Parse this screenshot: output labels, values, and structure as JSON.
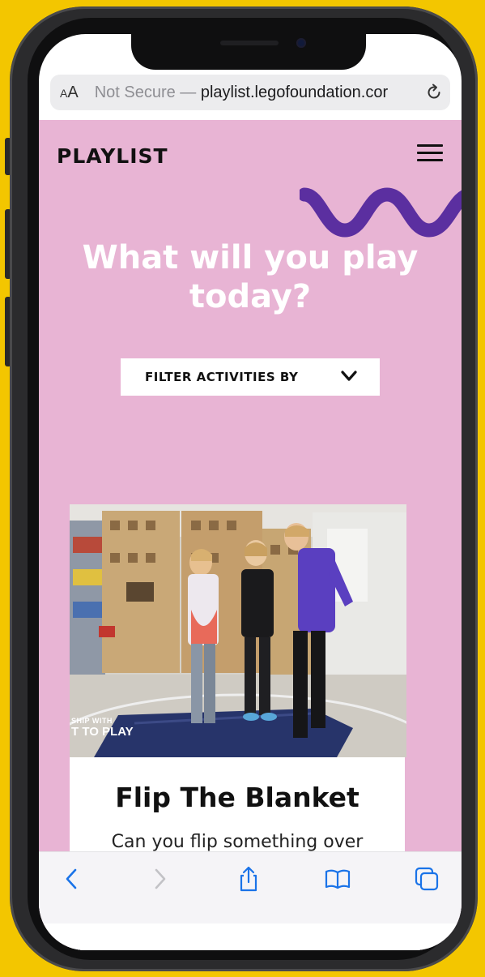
{
  "browser": {
    "text_size_label_small": "A",
    "text_size_label_large": "A",
    "security_label": "Not Secure —",
    "url_domain": "playlist.legofoundation.cor"
  },
  "site": {
    "logo": "PLAYLIST",
    "hero_line1": "What will you play",
    "hero_line2": "today?",
    "filter_label": "FILTER ACTIVITIES BY"
  },
  "card": {
    "title": "Flip The Blanket",
    "description": "Can you flip something over",
    "watermark_line1": "SHIP WITH",
    "watermark_line2": "T TO PLAY"
  },
  "colors": {
    "page_background": "#e8b4d4",
    "wave": "#5b2fa0",
    "hero_text": "#ffffff",
    "outer_background": "#f3c600",
    "browser_tint": "#1a73e8"
  },
  "icons": {
    "reload": "reload-icon",
    "menu": "hamburger-menu-icon",
    "filter": "chevron-down-icon",
    "back": "chevron-left-icon",
    "forward": "chevron-right-icon",
    "share": "share-icon",
    "bookmarks": "book-icon",
    "tabs": "tabs-icon"
  }
}
